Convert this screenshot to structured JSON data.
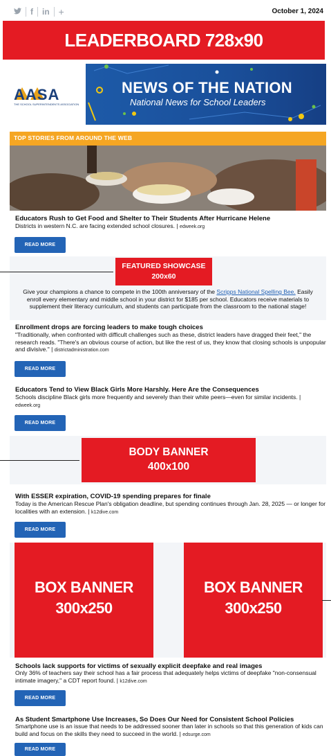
{
  "topbar": {
    "social_icons": [
      {
        "name": "twitter-icon",
        "glyph": "🐦︎"
      },
      {
        "name": "facebook-icon",
        "glyph": "f"
      },
      {
        "name": "linkedin-icon",
        "glyph": "in"
      },
      {
        "name": "plus-icon",
        "glyph": "+"
      }
    ],
    "date": "October 1, 2024"
  },
  "ads": {
    "leaderboard": "LEADERBOARD 728x90",
    "featured_line1": "FEATURED SHOWCASE",
    "featured_line2": "200x60",
    "body_line1": "BODY BANNER",
    "body_line2": "400x100",
    "box_line1": "BOX BANNER",
    "box_line2": "300x250"
  },
  "masthead": {
    "logo_text": "AASA",
    "logo_tagline": "THE SCHOOL SUPERINTENDENTS ASSOCIATION",
    "title": "NEWS OF THE NATION",
    "subtitle": "National News for School Leaders"
  },
  "section": {
    "label": "TOP STORIES FROM AROUND THE WEB"
  },
  "showcase": {
    "text_before": "Give your champions a chance to compete in the 100th anniversary of the ",
    "link": "Scripps National Spelling Bee.",
    "text_after": " Easily enroll every elementary and middle school in your district for $185 per school. Educators receive materials to supplement their literacy curriculum, and students can participate from the classroom to the national stage!"
  },
  "read_more_label": "READ MORE",
  "stories": [
    {
      "title": "Educators Rush to Get Food and Shelter to Their Students After Hurricane Helene",
      "desc": "Districts in western N.C. are facing extended school closures. |",
      "source": "edweek.org"
    },
    {
      "title": "Enrollment drops are forcing leaders to make tough choices",
      "desc": "\"Traditionally, when confronted with difficult challenges such as these, district leaders have dragged their feet,\" the research reads. \"There's an obvious course of action, but like the rest of us, they know that closing schools is unpopular and divisive.\" |",
      "source": "districtadministration.com"
    },
    {
      "title": "Educators Tend to View Black Girls More Harshly. Here Are the Consequences",
      "desc": "Schools discipline Black girls more frequently and severely than their white peers—even for similar incidents. |",
      "source": "edweek.org"
    },
    {
      "title": "With ESSER expiration, COVID-19 spending prepares for finale",
      "desc": "Today is the American Rescue Plan's obligation deadline, but spending continues through Jan. 28, 2025 — or longer for localities with an extension. |",
      "source": "k12dive.com"
    },
    {
      "title": "Schools lack supports for victims of sexually explicit deepfake and real images",
      "desc": "Only 36% of teachers say their school has a fair process that adequately helps victims of deepfake \"non-consensual intimate imagery,\" a CDT report found. |",
      "source": "k12dive.com"
    },
    {
      "title": "As Student Smartphone Use Increases, So Does Our Need for Consistent School Policies",
      "desc": "Smartphone use is an issue that needs to be addressed sooner than later in schools so that this generation of kids can build and focus on the skills they need to succeed in the world. |",
      "source": "edsurge.com"
    }
  ]
}
